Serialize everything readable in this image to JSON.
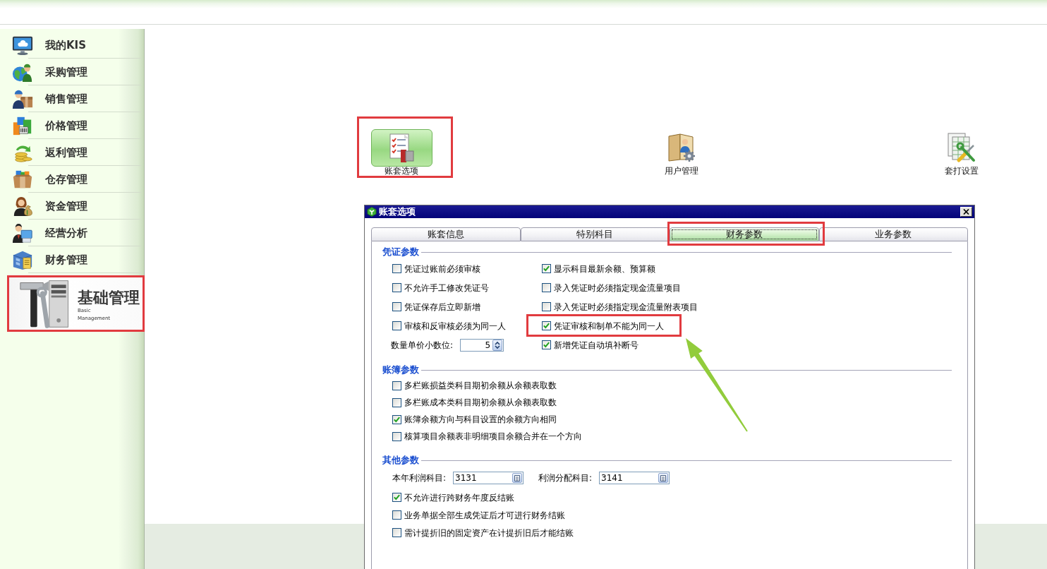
{
  "sidebar": {
    "items": [
      {
        "label": "我的KIS"
      },
      {
        "label": "采购管理"
      },
      {
        "label": "销售管理"
      },
      {
        "label": "价格管理"
      },
      {
        "label": "返利管理"
      },
      {
        "label": "仓存管理"
      },
      {
        "label": "资金管理"
      },
      {
        "label": "经营分析"
      },
      {
        "label": "财务管理"
      }
    ],
    "banner": {
      "title": "基础管理",
      "subtitle_line_1": "Basic",
      "subtitle_line_2": "Management",
      "highlighted": true
    }
  },
  "modules": [
    {
      "label": "账套选项",
      "selected": true,
      "highlighted": true
    },
    {
      "label": "用户管理",
      "selected": false,
      "highlighted": false
    },
    {
      "label": "套打设置",
      "selected": false,
      "highlighted": false
    }
  ],
  "dialog": {
    "title": "账套选项",
    "tabs": [
      {
        "label": "账套信息",
        "selected": false,
        "highlighted": false
      },
      {
        "label": "特别科目",
        "selected": false,
        "highlighted": false
      },
      {
        "label": "财务参数",
        "selected": true,
        "highlighted": true
      },
      {
        "label": "业务参数",
        "selected": false,
        "highlighted": false
      }
    ],
    "sections": [
      {
        "title": "凭证参数",
        "columns": [
          [
            {
              "kind": "checkbox",
              "label": "凭证过账前必须审核",
              "checked": false,
              "highlighted": false
            },
            {
              "kind": "checkbox",
              "label": "不允许手工修改凭证号",
              "checked": false,
              "highlighted": false
            },
            {
              "kind": "checkbox",
              "label": "凭证保存后立即新增",
              "checked": false,
              "highlighted": false
            },
            {
              "kind": "checkbox",
              "label": "审核和反审核必须为同一人",
              "checked": false,
              "highlighted": false
            },
            {
              "kind": "spinner",
              "label": "数量单价小数位:",
              "value": "5"
            }
          ],
          [
            {
              "kind": "checkbox",
              "label": "显示科目最新余额、预算额",
              "checked": true,
              "highlighted": false
            },
            {
              "kind": "checkbox",
              "label": "录入凭证时必须指定现金流量项目",
              "checked": false,
              "highlighted": false
            },
            {
              "kind": "checkbox",
              "label": "录入凭证时必须指定现金流量附表项目",
              "checked": false,
              "highlighted": false
            },
            {
              "kind": "checkbox",
              "label": "凭证审核和制单不能为同一人",
              "checked": true,
              "highlighted": true
            },
            {
              "kind": "checkbox",
              "label": "新增凭证自动填补断号",
              "checked": true,
              "highlighted": false
            }
          ]
        ]
      },
      {
        "title": "账簿参数",
        "columns": [
          [
            {
              "kind": "checkbox",
              "label": "多栏账损益类科目期初余额从余额表取数",
              "checked": false,
              "highlighted": false
            },
            {
              "kind": "checkbox",
              "label": "多栏账成本类科目期初余额从余额表取数",
              "checked": false,
              "highlighted": false
            },
            {
              "kind": "checkbox",
              "label": "账簿余额方向与科目设置的余额方向相同",
              "checked": true,
              "highlighted": false
            },
            {
              "kind": "checkbox",
              "label": "核算项目余额表非明细项目余额合并在一个方向",
              "checked": false,
              "highlighted": false
            }
          ]
        ]
      },
      {
        "title": "其他参数",
        "columns": [
          [
            {
              "kind": "lookups",
              "fields": [
                {
                  "label": "本年利润科目:",
                  "value": "3131"
                },
                {
                  "label": "利润分配科目:",
                  "value": "3141"
                }
              ]
            },
            {
              "kind": "checkbox",
              "label": "不允许进行跨财务年度反结账",
              "checked": true,
              "highlighted": false
            },
            {
              "kind": "checkbox",
              "label": "业务单据全部生成凭证后才可进行财务结账",
              "checked": false,
              "highlighted": false
            },
            {
              "kind": "checkbox",
              "label": "需计提折旧的固定资产在计提折旧后才能结账",
              "checked": false,
              "highlighted": false
            }
          ]
        ]
      }
    ]
  }
}
